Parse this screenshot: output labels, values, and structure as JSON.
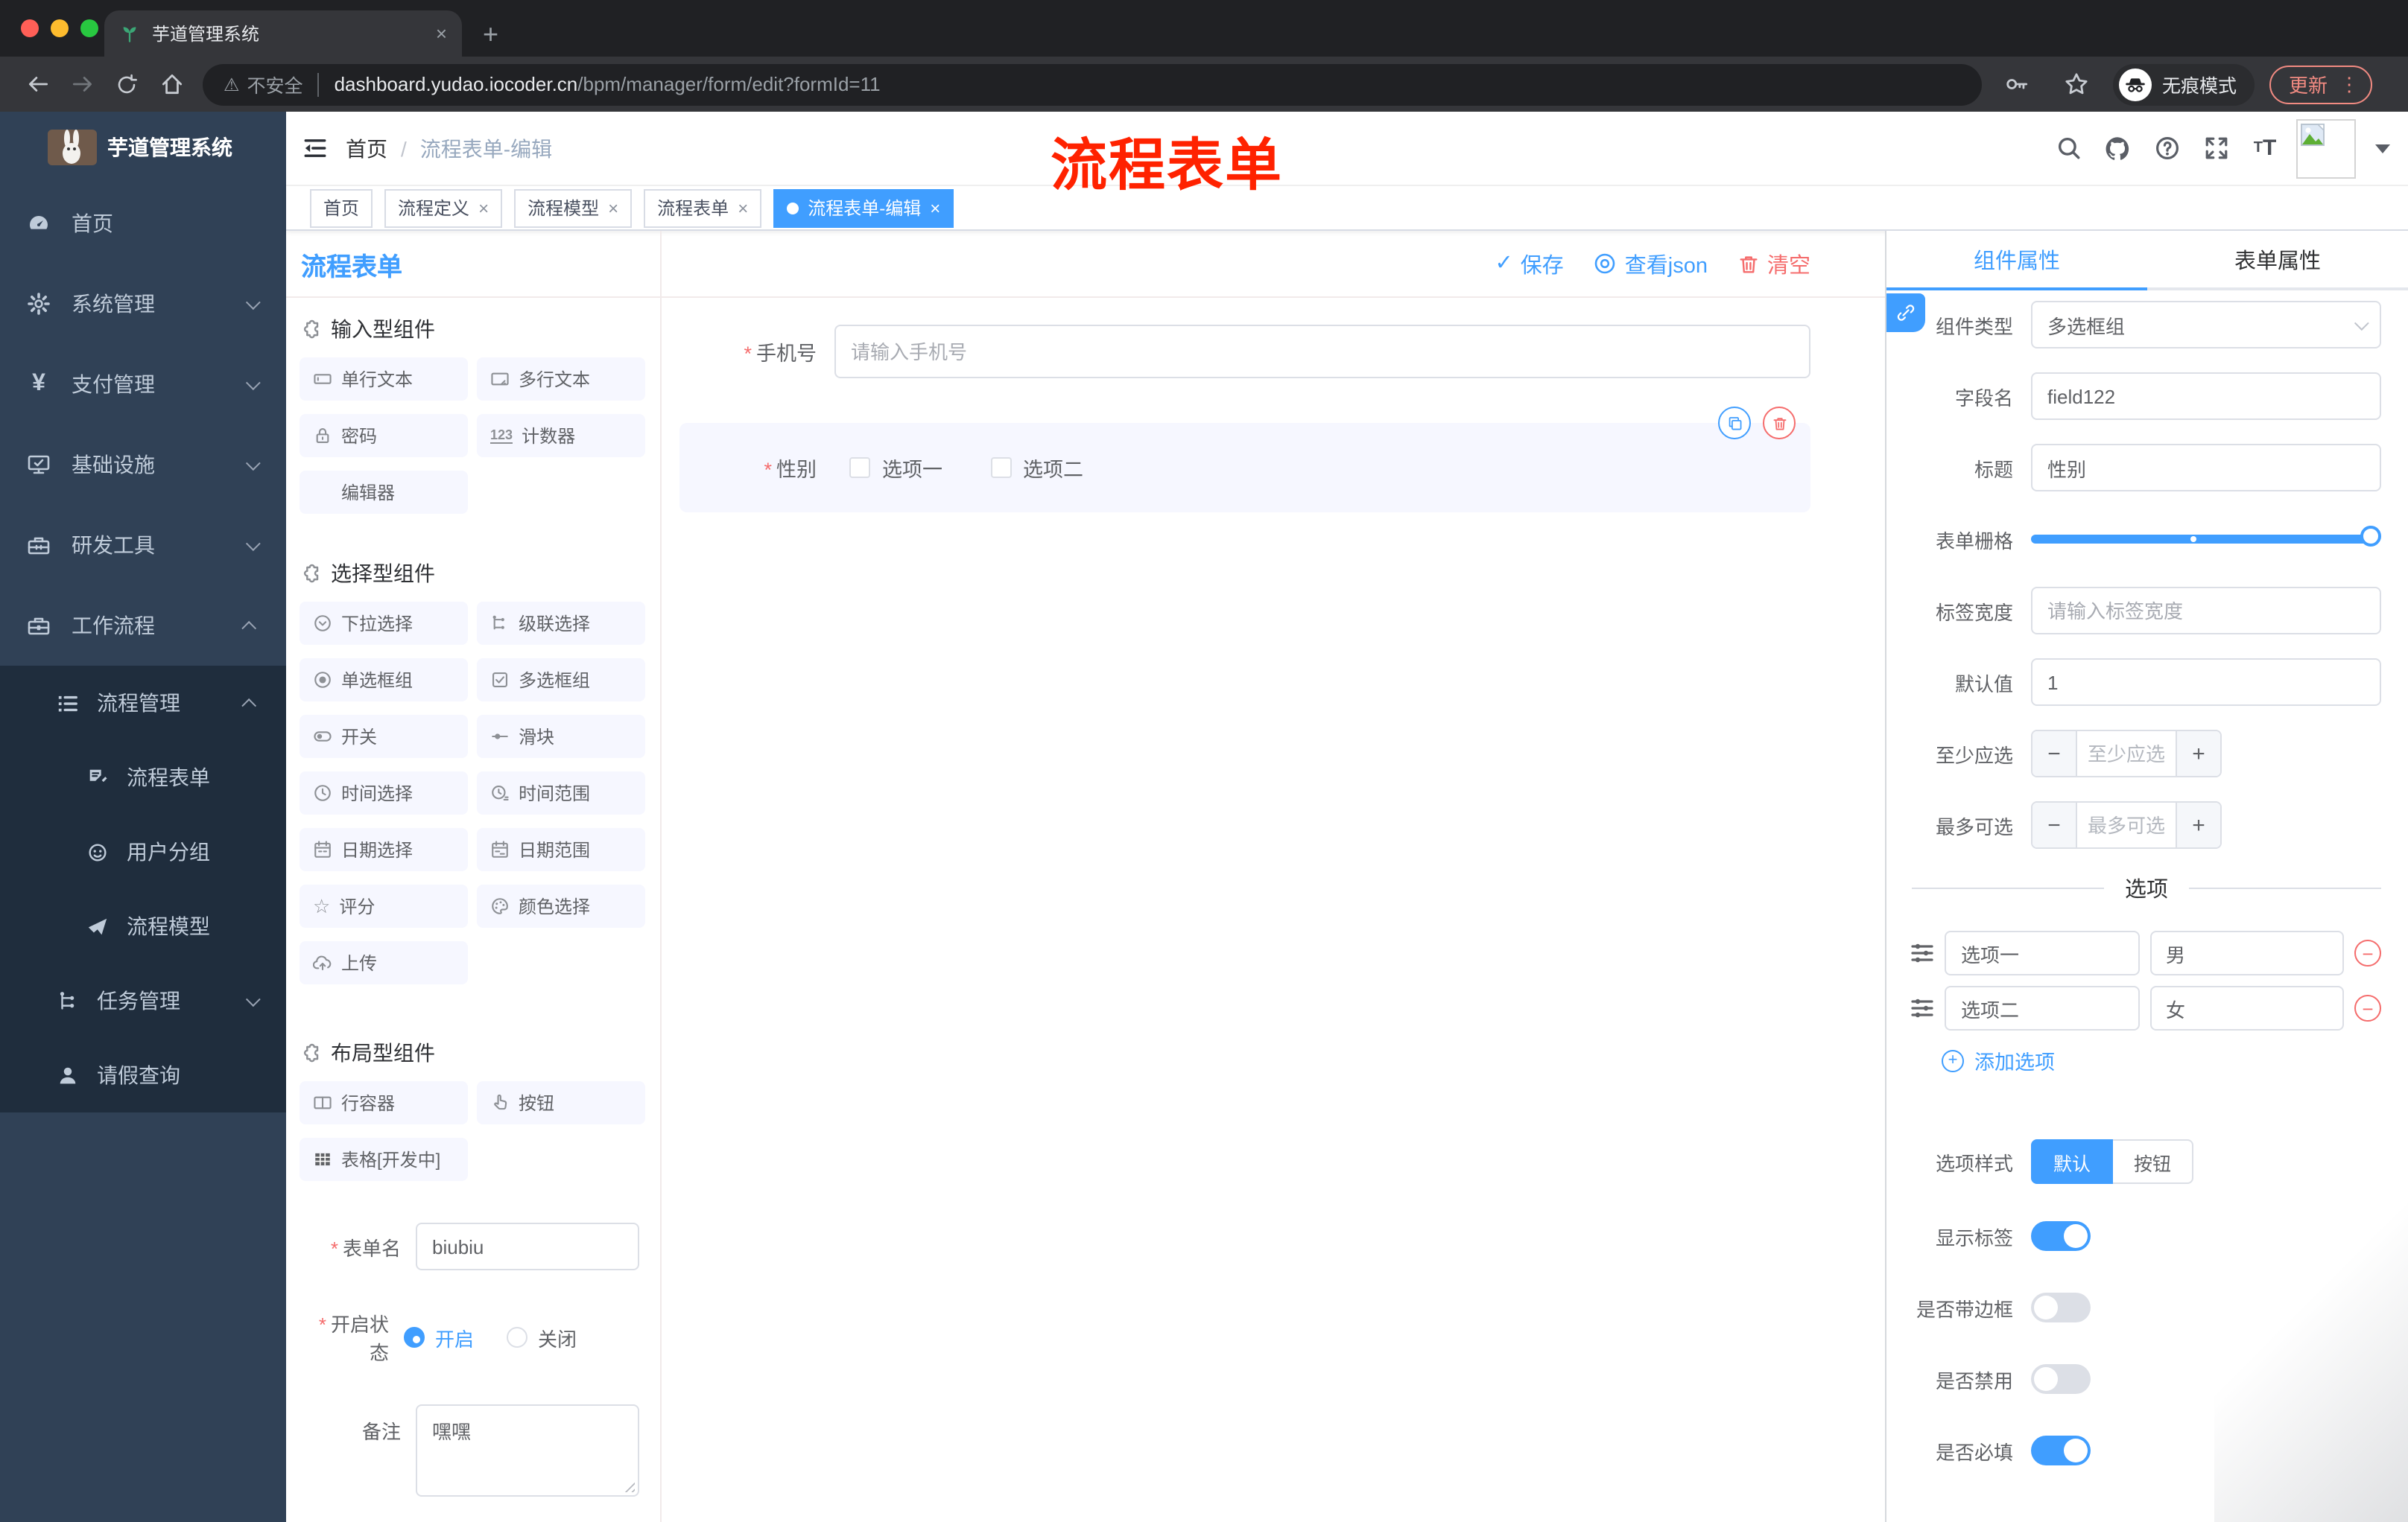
{
  "colors": {
    "primary": "#409eff",
    "danger": "#f56c6c",
    "sidebar_bg": "#304156",
    "submenu_bg": "#1f2d3d",
    "active_tag": "#409eff",
    "annotation_red": "#ff2200"
  },
  "browser": {
    "tab_title": "芋道管理系统",
    "security": "不安全",
    "url_host": "dashboard.yudao.iocoder.cn",
    "url_path": "/bpm/manager/form/edit?formId=11",
    "incognito": "无痕模式",
    "update": "更新"
  },
  "annotation": "流程表单",
  "sidebar": {
    "title": "芋道管理系统",
    "items": [
      {
        "label": "首页"
      },
      {
        "label": "系统管理"
      },
      {
        "label": "支付管理"
      },
      {
        "label": "基础设施"
      },
      {
        "label": "研发工具"
      },
      {
        "label": "工作流程"
      }
    ],
    "submenu": [
      {
        "label": "流程管理"
      },
      {
        "label": "流程表单"
      },
      {
        "label": "用户分组"
      },
      {
        "label": "流程模型"
      },
      {
        "label": "任务管理"
      },
      {
        "label": "请假查询"
      }
    ]
  },
  "header": {
    "breadcrumb": [
      "首页",
      "流程表单-编辑"
    ],
    "separator": "/"
  },
  "tags": [
    {
      "label": "首页"
    },
    {
      "label": "流程定义"
    },
    {
      "label": "流程模型"
    },
    {
      "label": "流程表单"
    },
    {
      "label": "流程表单-编辑"
    }
  ],
  "designer": {
    "logo": "流程表单",
    "actions": {
      "save": "保存",
      "view_json": "查看json",
      "clear": "清空"
    },
    "sections": [
      {
        "title": "输入型组件",
        "items": [
          "单行文本",
          "多行文本",
          "密码",
          "计数器",
          "编辑器"
        ]
      },
      {
        "title": "选择型组件",
        "items": [
          "下拉选择",
          "级联选择",
          "单选框组",
          "多选框组",
          "开关",
          "滑块",
          "时间选择",
          "时间范围",
          "日期选择",
          "日期范围",
          "评分",
          "颜色选择",
          "上传"
        ]
      },
      {
        "title": "布局型组件",
        "items": [
          "行容器",
          "按钮",
          "表格[开发中]"
        ]
      }
    ],
    "form": {
      "name_label": "表单名",
      "name_value": "biubiu",
      "status_label": "开启状态",
      "status_on": "开启",
      "status_off": "关闭",
      "remark_label": "备注",
      "remark_value": "嘿嘿"
    }
  },
  "canvas": {
    "phone": {
      "label": "手机号",
      "placeholder": "请输入手机号"
    },
    "gender": {
      "label": "性别",
      "option1": "选项一",
      "option2": "选项二"
    }
  },
  "inspector": {
    "tab_component": "组件属性",
    "tab_form": "表单属性",
    "rows": {
      "type_label": "组件类型",
      "type_value": "多选框组",
      "field_label": "字段名",
      "field_value": "field122",
      "title_label": "标题",
      "title_value": "性别",
      "grid_label": "表单栅格",
      "width_label": "标签宽度",
      "width_placeholder": "请输入标签宽度",
      "default_label": "默认值",
      "default_value": "1",
      "min_label": "至少应选",
      "min_placeholder": "至少应选",
      "max_label": "最多可选",
      "max_placeholder": "最多可选"
    },
    "options": {
      "divider": "选项",
      "row1_label": "选项一",
      "row1_value": "男",
      "row2_label": "选项二",
      "row2_value": "女",
      "add": "添加选项"
    },
    "style": {
      "label": "选项样式",
      "opt_default": "默认",
      "opt_button": "按钮"
    },
    "switches": {
      "show_label": "显示标签",
      "border": "是否带边框",
      "disabled": "是否禁用",
      "required": "是否必填"
    }
  }
}
